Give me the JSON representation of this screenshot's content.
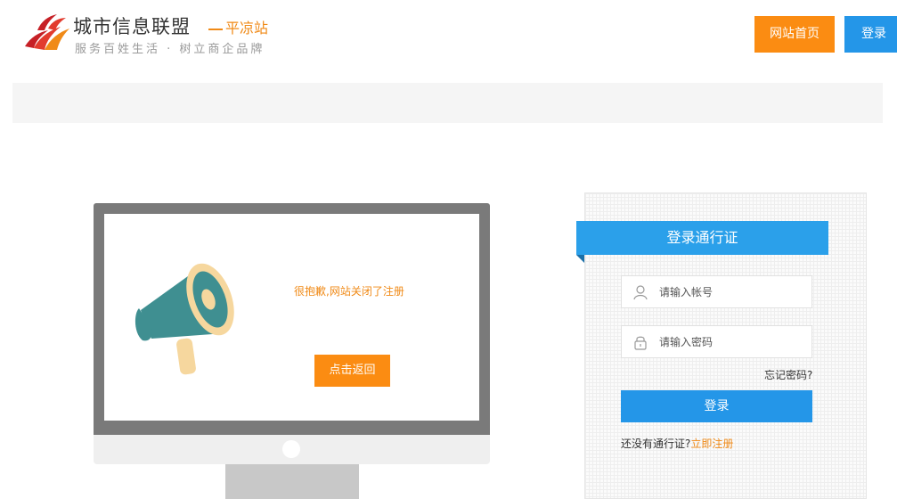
{
  "header": {
    "logo_title": "城市信息联盟",
    "logo_city": "平凉站",
    "logo_slogan": "服务百姓生活 · 树立商企品牌",
    "nav_home": "网站首页",
    "nav_login": "登录"
  },
  "notice": {
    "message": "很抱歉,网站关闭了注册",
    "back_button": "点击返回"
  },
  "login": {
    "title": "登录通行证",
    "username_placeholder": "请输入帐号",
    "password_placeholder": "请输入密码",
    "forgot": "忘记密码?",
    "submit": "登录",
    "no_account": "还没有通行证?",
    "register_link": "立即注册"
  },
  "icons": {
    "logo": "flame-logo-icon",
    "megaphone": "megaphone-icon",
    "user": "user-icon",
    "lock": "lock-icon"
  },
  "colors": {
    "accent_orange": "#fb8c12",
    "accent_blue": "#2496e8",
    "ribbon_blue": "#2ba0ea"
  }
}
